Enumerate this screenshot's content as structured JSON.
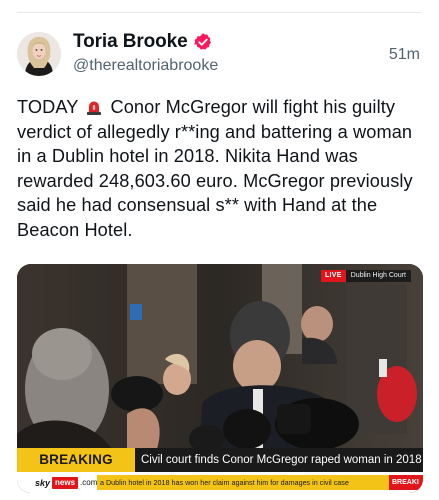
{
  "post": {
    "display_name": "Toria Brooke",
    "handle": "@therealtoriabrooke",
    "timestamp": "51m",
    "verified": true,
    "text_before_emoji": "TODAY",
    "emoji_icon": "police-siren-icon",
    "text_after_emoji": " Conor McGregor will fight his guilty verdict of allegedly r**ing and battering a woman in a Dublin hotel in 2018. Nikita Hand was rewarded 248,603.60 euro. McGregor previously said he had consensual s** with Hand at the Beacon Hotel."
  },
  "media": {
    "live_tag": "LIVE",
    "live_location": "Dublin High Court",
    "breaking_label": "BREAKING NEWS",
    "breaking_headline": "Civil court finds Conor McGregor raped woman in 2018",
    "logo_sky": "sky",
    "logo_news": "news",
    "logo_com": ".com",
    "ticker_text": "a Dublin hotel in 2018 has won her claim against him for damages in civil case",
    "ticker_end": "BREAKI"
  },
  "colors": {
    "verified": "#f9185d",
    "siren": "#e0252a",
    "sky_red": "#e1161b",
    "breaking_yellow": "#f4c318"
  }
}
